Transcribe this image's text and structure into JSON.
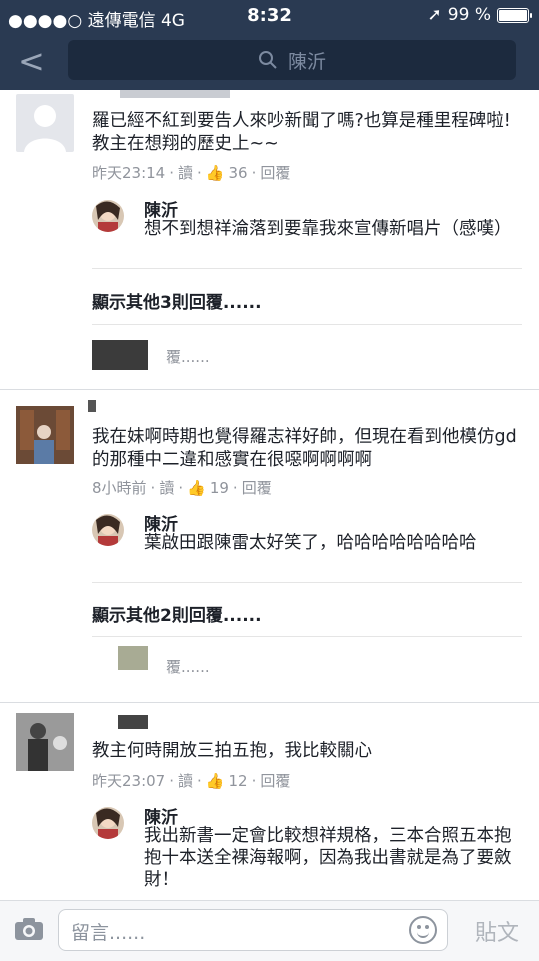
{
  "status": {
    "carrier": "●●●●○ 遠傳電信  4G",
    "time": "8:32",
    "battery": "99 %",
    "battery_level": 0.99
  },
  "nav": {
    "search_text": "陳沂"
  },
  "comments": [
    {
      "text": "羅已經不紅到要告人來吵新聞了嗎?也算是種里程碑啦!教主在想翔的歷史上~~",
      "time": "昨天23:14",
      "read": "讀",
      "likes": "36",
      "reply": "回覆",
      "reply_name": "陳沂",
      "reply_text": "想不到想祥淪落到要靠我來宣傳新唱片（感嘆）",
      "more": "顯示其他3則回覆......",
      "partial": "覆......"
    },
    {
      "text": "我在妹啊時期也覺得羅志祥好帥，但現在看到他模仿gd的那種中二違和感實在很噁啊啊啊啊",
      "time": "8小時前",
      "read": "讀",
      "likes": "19",
      "reply": "回覆",
      "reply_name": "陳沂",
      "reply_text": "葉啟田跟陳雷太好笑了，哈哈哈哈哈哈哈哈",
      "more": "顯示其他2則回覆......",
      "partial": "覆......"
    },
    {
      "text": "教主何時開放三拍五抱，我比較關心",
      "time": "昨天23:07",
      "read": "讀",
      "likes": "12",
      "reply": "回覆",
      "reply_name": "陳沂",
      "reply_text": "我出新書一定會比較想祥規格，三本合照五本抱抱十本送全裸海報啊，因為我出書就是為了要斂財！"
    }
  ],
  "footer": {
    "placeholder": "留言......",
    "post_label": "貼文"
  },
  "colors": {
    "navbar": "#2a3a52",
    "like": "#4267b2"
  }
}
